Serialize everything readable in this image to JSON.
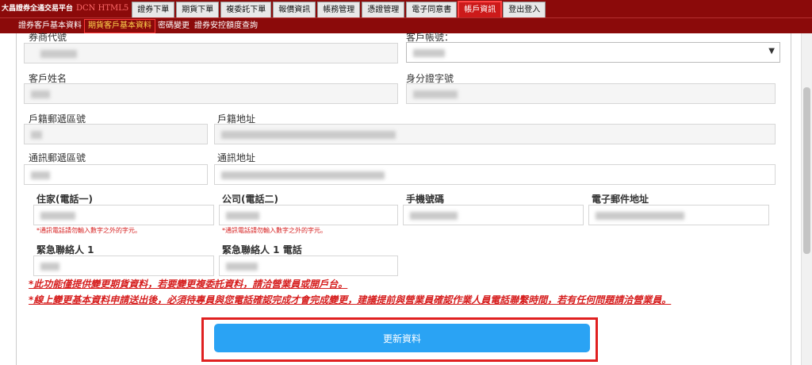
{
  "topbar": {
    "brand": "大昌證券全通交易平台",
    "brand_sub": "DCN HTML5",
    "tabs": [
      "證券下單",
      "期貨下單",
      "複委託下單",
      "報價資訊",
      "帳務管理",
      "憑證管理",
      "電子同意書",
      "帳戶資訊",
      "登出登入"
    ],
    "active_tab": "帳戶資訊"
  },
  "subnav": {
    "items": [
      "證券客戶基本資料",
      "期貨客戶基本資料",
      "密碼變更",
      "證券安控額度查詢"
    ],
    "active": "期貨客戶基本資料"
  },
  "form": {
    "broker_code_label": "券商代號",
    "account_label": "客戶帳號：",
    "name_label": "客戶姓名",
    "id_label": "身分證字號",
    "reg_zip_label": "戶籍郵遞區號",
    "reg_addr_label": "戶籍地址",
    "mail_zip_label": "通訊郵遞區號",
    "mail_addr_label": "通訊地址",
    "home_phone_label": "住家(電話一)",
    "office_phone_label": "公司(電話二)",
    "mobile_label": "手機號碼",
    "email_label": "電子郵件地址",
    "phone_hint": "*通訊電話請勿輸入數字之外的字元。",
    "emergency_contact_label": "緊急聯絡人 1",
    "emergency_phone_label": "緊急聯絡人 1 電話"
  },
  "notices": {
    "line1": "*此功能僅提供變更期貨資料，若要變更複委託資料，請洽營業員或開戶台。",
    "line2": "*線上變更基本資料申請送出後，必須待專員與您電話確認完成才會完成變更，建議提前與營業員確認作業人員電話聯繫時間，若有任何問題請洽營業員。"
  },
  "actions": {
    "update_label": "更新資料"
  },
  "colors": {
    "header_bg": "#8b0a0a",
    "active_tab": "#cc1a1a",
    "button": "#2aa3f4",
    "warning_text": "#d61f1f"
  }
}
